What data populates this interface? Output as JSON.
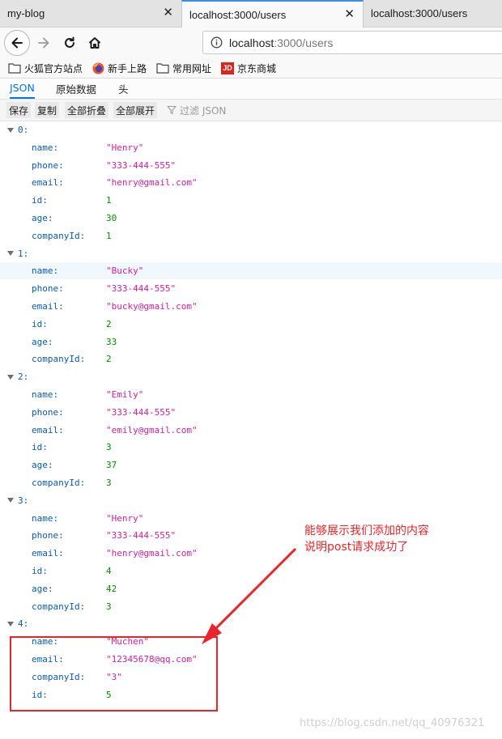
{
  "browser": {
    "tabs": [
      {
        "title": "my-blog",
        "close": "✕"
      },
      {
        "title": "localhost:3000/users",
        "close": "✕"
      },
      {
        "title": "localhost:3000/users"
      }
    ],
    "url": {
      "host": "localhost",
      "path": ":3000/users"
    },
    "bookmarks": [
      {
        "label": "火狐官方站点",
        "icon": "folder-icon"
      },
      {
        "label": "新手上路",
        "icon": "firefox-icon"
      },
      {
        "label": "常用网址",
        "icon": "folder-icon"
      },
      {
        "label": "京东商城",
        "icon": "jd-icon",
        "badge": "JD"
      }
    ]
  },
  "viewer": {
    "tabs": [
      "JSON",
      "原始数据",
      "头"
    ],
    "toolbar": {
      "save": "保存",
      "copy": "复制",
      "collapse_all": "全部折叠",
      "expand_all": "全部展开",
      "filter_placeholder": "过滤 JSON"
    }
  },
  "users": [
    {
      "index": "0:",
      "fields": [
        {
          "key": "name:",
          "value": "\"Henry\"",
          "type": "str"
        },
        {
          "key": "phone:",
          "value": "\"333-444-555\"",
          "type": "str"
        },
        {
          "key": "email:",
          "value": "\"henry@gmail.com\"",
          "type": "str"
        },
        {
          "key": "id:",
          "value": "1",
          "type": "num"
        },
        {
          "key": "age:",
          "value": "30",
          "type": "num"
        },
        {
          "key": "companyId:",
          "value": "1",
          "type": "num"
        }
      ]
    },
    {
      "index": "1:",
      "fields": [
        {
          "key": "name:",
          "value": "\"Bucky\"",
          "type": "str"
        },
        {
          "key": "phone:",
          "value": "\"333-444-555\"",
          "type": "str"
        },
        {
          "key": "email:",
          "value": "\"bucky@gmail.com\"",
          "type": "str"
        },
        {
          "key": "id:",
          "value": "2",
          "type": "num"
        },
        {
          "key": "age:",
          "value": "33",
          "type": "num"
        },
        {
          "key": "companyId:",
          "value": "2",
          "type": "num"
        }
      ]
    },
    {
      "index": "2:",
      "fields": [
        {
          "key": "name:",
          "value": "\"Emily\"",
          "type": "str"
        },
        {
          "key": "phone:",
          "value": "\"333-444-555\"",
          "type": "str"
        },
        {
          "key": "email:",
          "value": "\"emily@gmail.com\"",
          "type": "str"
        },
        {
          "key": "id:",
          "value": "3",
          "type": "num"
        },
        {
          "key": "age:",
          "value": "37",
          "type": "num"
        },
        {
          "key": "companyId:",
          "value": "3",
          "type": "num"
        }
      ]
    },
    {
      "index": "3:",
      "fields": [
        {
          "key": "name:",
          "value": "\"Henry\"",
          "type": "str"
        },
        {
          "key": "phone:",
          "value": "\"333-444-555\"",
          "type": "str"
        },
        {
          "key": "email:",
          "value": "\"henry@gmail.com\"",
          "type": "str"
        },
        {
          "key": "id:",
          "value": "4",
          "type": "num"
        },
        {
          "key": "age:",
          "value": "42",
          "type": "num"
        },
        {
          "key": "companyId:",
          "value": "3",
          "type": "num"
        }
      ]
    },
    {
      "index": "4:",
      "fields": [
        {
          "key": "name:",
          "value": "\"Muchen\"",
          "type": "str"
        },
        {
          "key": "email:",
          "value": "\"12345678@qq.com\"",
          "type": "str"
        },
        {
          "key": "companyId:",
          "value": "\"3\"",
          "type": "str"
        },
        {
          "key": "id:",
          "value": "5",
          "type": "num"
        }
      ]
    }
  ],
  "annotation": {
    "line1": "能够展示我们添加的内容",
    "line2": "说明post请求成功了",
    "color": "#e8252a"
  },
  "watermark": "https://blog.csdn.net/qq_40976321"
}
